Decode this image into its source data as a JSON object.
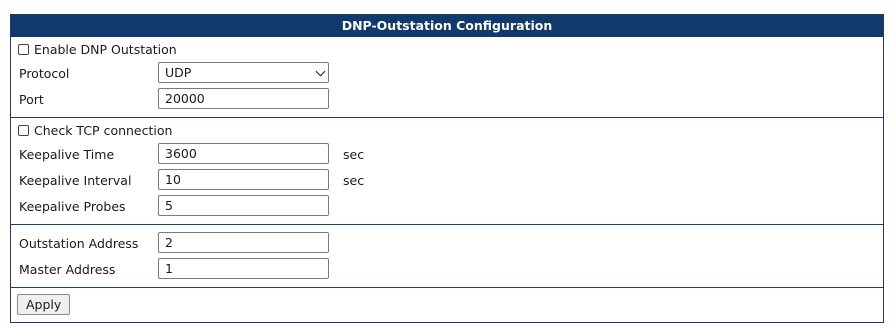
{
  "title": "DNP-Outstation Configuration",
  "general": {
    "enable_label": "Enable DNP Outstation",
    "enable_checked": false,
    "protocol_label": "Protocol",
    "protocol_value": "UDP",
    "port_label": "Port",
    "port_value": "20000"
  },
  "tcp": {
    "check_label": "Check TCP connection",
    "check_checked": false,
    "keepalive_time_label": "Keepalive Time",
    "keepalive_time_value": "3600",
    "keepalive_time_unit": "sec",
    "keepalive_interval_label": "Keepalive Interval",
    "keepalive_interval_value": "10",
    "keepalive_interval_unit": "sec",
    "keepalive_probes_label": "Keepalive Probes",
    "keepalive_probes_value": "5"
  },
  "addresses": {
    "outstation_label": "Outstation Address",
    "outstation_value": "2",
    "master_label": "Master Address",
    "master_value": "1"
  },
  "apply_label": "Apply"
}
